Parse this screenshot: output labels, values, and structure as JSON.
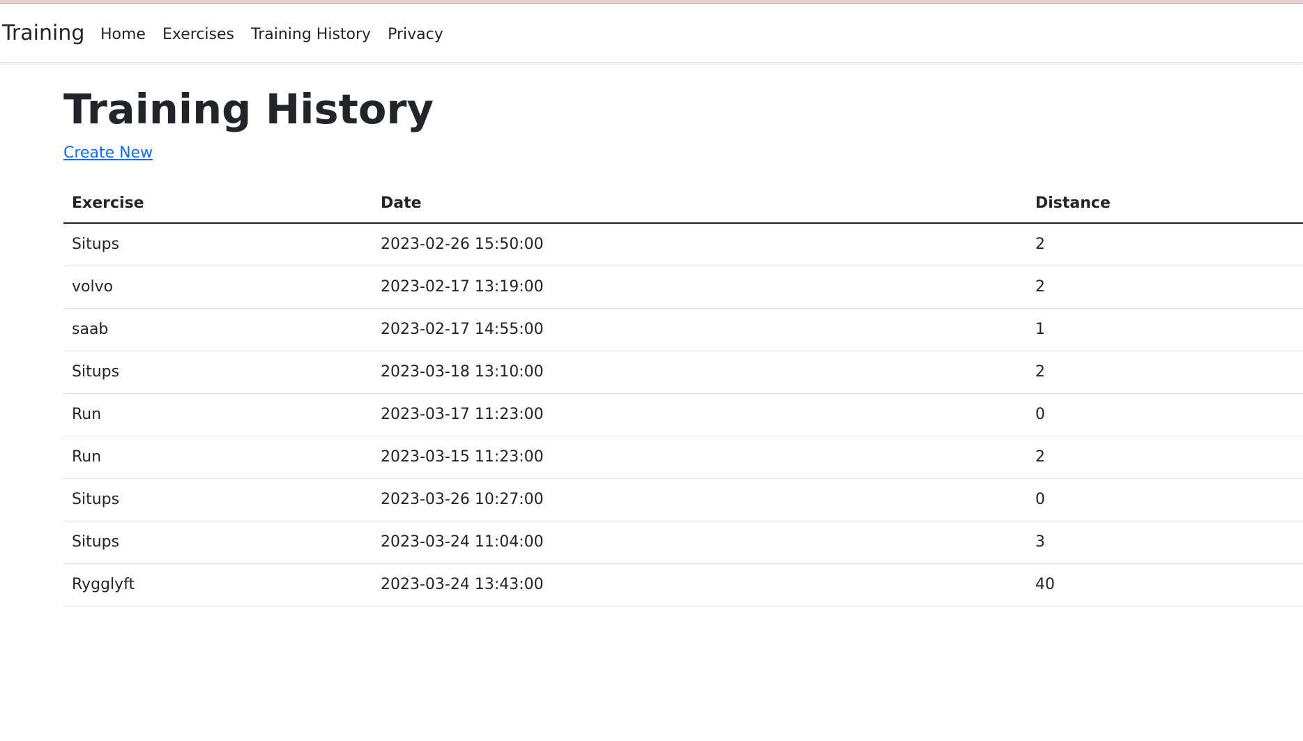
{
  "nav": {
    "brand": "Training",
    "links": [
      {
        "label": "Home"
      },
      {
        "label": "Exercises"
      },
      {
        "label": "Training History"
      },
      {
        "label": "Privacy"
      }
    ]
  },
  "page": {
    "title": "Training History",
    "create_label": "Create New"
  },
  "table": {
    "headers": [
      "Exercise",
      "Date",
      "Distance"
    ],
    "rows": [
      {
        "exercise": "Situps",
        "date": "2023-02-26 15:50:00",
        "distance": "2"
      },
      {
        "exercise": "volvo",
        "date": "2023-02-17 13:19:00",
        "distance": "2"
      },
      {
        "exercise": "saab",
        "date": "2023-02-17 14:55:00",
        "distance": "1"
      },
      {
        "exercise": "Situps",
        "date": "2023-03-18 13:10:00",
        "distance": "2"
      },
      {
        "exercise": "Run",
        "date": "2023-03-17 11:23:00",
        "distance": "0"
      },
      {
        "exercise": "Run",
        "date": "2023-03-15 11:23:00",
        "distance": "2"
      },
      {
        "exercise": "Situps",
        "date": "2023-03-26 10:27:00",
        "distance": "0"
      },
      {
        "exercise": "Situps",
        "date": "2023-03-24 11:04:00",
        "distance": "3"
      },
      {
        "exercise": "Rygglyft",
        "date": "2023-03-24 13:43:00",
        "distance": "40"
      }
    ]
  },
  "colors": {
    "link": "#0d6efd",
    "text": "#212529",
    "row_border": "#dee2e6"
  }
}
